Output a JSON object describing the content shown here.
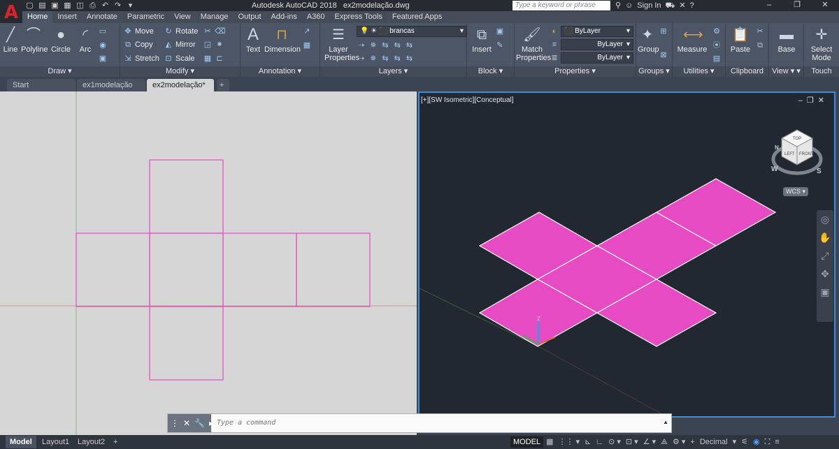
{
  "titlebar": {
    "app": "Autodesk AutoCAD 2018",
    "file": "ex2modelação.dwg",
    "search_placeholder": "Type a keyword or phrase",
    "signin": "Sign In"
  },
  "tabs": [
    "Home",
    "Insert",
    "Annotate",
    "Parametric",
    "View",
    "Manage",
    "Output",
    "Add-ins",
    "A360",
    "Express Tools",
    "Featured Apps"
  ],
  "ribbon": {
    "draw": {
      "title": "Draw",
      "line": "Line",
      "polyline": "Polyline",
      "circle": "Circle",
      "arc": "Arc"
    },
    "modify": {
      "title": "Modify",
      "move": "Move",
      "rotate": "Rotate",
      "copy": "Copy",
      "mirror": "Mirror",
      "stretch": "Stretch",
      "scale": "Scale"
    },
    "annotation": {
      "title": "Annotation",
      "text": "Text",
      "dimension": "Dimension"
    },
    "layers": {
      "title": "Layers",
      "layer_properties_1": "Layer",
      "layer_properties_2": "Properties",
      "current_layer": "brancas"
    },
    "block": {
      "title": "Block",
      "insert": "Insert"
    },
    "properties": {
      "title": "Properties",
      "match_1": "Match",
      "match_2": "Properties",
      "color": "ByLayer",
      "linetype": "ByLayer",
      "lineweight": "ByLayer"
    },
    "groups": {
      "title": "Groups",
      "group": "Group"
    },
    "utilities": {
      "title": "Utilities",
      "measure": "Measure"
    },
    "clipboard": {
      "title": "Clipboard",
      "paste": "Paste"
    },
    "view": {
      "title": "View",
      "base": "Base"
    },
    "touch": {
      "title": "Touch",
      "select_1": "Select",
      "select_2": "Mode"
    }
  },
  "filetabs": [
    "Start",
    "ex1modelação",
    "ex2modelação*"
  ],
  "viewport": {
    "label": "[+][SW Isometric][Conceptual]",
    "viewcube_top": "TOP",
    "viewcube_left": "LEFT",
    "viewcube_front": "FRONT",
    "compass_w": "W",
    "compass_s": "S",
    "compass_n": "N",
    "wcs": "WCS",
    "ucs_z": "Z"
  },
  "command": {
    "placeholder": "Type a command"
  },
  "status": {
    "model": "Model",
    "layout1": "Layout1",
    "layout2": "Layout2",
    "space": "MODEL",
    "units": "Decimal"
  },
  "colors": {
    "net": "#e64bc3",
    "accent": "#3a8fd6",
    "app_red": "#d8232a"
  }
}
